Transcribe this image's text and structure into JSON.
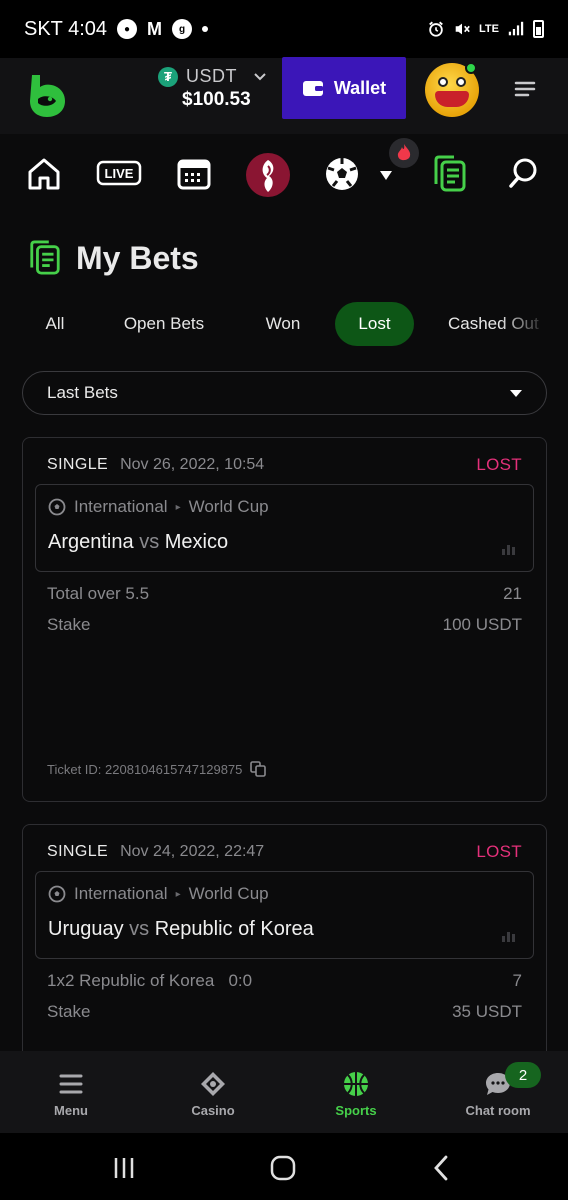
{
  "status_bar": {
    "carrier": "SKT",
    "time": "4:04",
    "network": "LTE"
  },
  "header": {
    "currency": "USDT",
    "balance": "$100.53",
    "wallet_label": "Wallet"
  },
  "nav_icons": [
    "home-icon",
    "live-icon",
    "calendar-icon",
    "world-cup-icon",
    "soccer-ball-icon",
    "hot-fire-icon",
    "my-bets-icon",
    "search-icon"
  ],
  "nav": {
    "live_label": "LIVE"
  },
  "page": {
    "title": "My Bets"
  },
  "filters": [
    "All",
    "Open Bets",
    "Won",
    "Lost",
    "Cashed Out"
  ],
  "active_filter": "Lost",
  "dropdown": {
    "selected": "Last Bets"
  },
  "bets": [
    {
      "type": "SINGLE",
      "date": "Nov 26, 2022, 10:54",
      "status": "LOST",
      "category": "International",
      "league": "World Cup",
      "home": "Argentina",
      "vs": "vs",
      "away": "Mexico",
      "selection": "Total over 5.5",
      "odds": "21",
      "stake_label": "Stake",
      "stake": "100 USDT",
      "ticket": "Ticket ID: 2208104615747129875"
    },
    {
      "type": "SINGLE",
      "date": "Nov 24, 2022, 22:47",
      "status": "LOST",
      "category": "International",
      "league": "World Cup",
      "home": "Uruguay",
      "vs": "vs",
      "away": "Republic of Korea",
      "selection": "1x2 Republic of Korea   0:0",
      "odds": "7",
      "stake_label": "Stake",
      "stake": "35 USDT"
    }
  ],
  "bottom_nav": [
    {
      "label": "Menu",
      "icon": "hamburger-icon"
    },
    {
      "label": "Casino",
      "icon": "casino-chip-icon"
    },
    {
      "label": "Sports",
      "icon": "basketball-icon"
    },
    {
      "label": "Chat room",
      "icon": "chat-icon"
    }
  ],
  "chat_badge": "2",
  "colors": {
    "accent_green": "#46d04a",
    "wallet_purple": "#3b16b8",
    "lost_pink": "#e4307a",
    "active_chip": "#0d5616"
  }
}
